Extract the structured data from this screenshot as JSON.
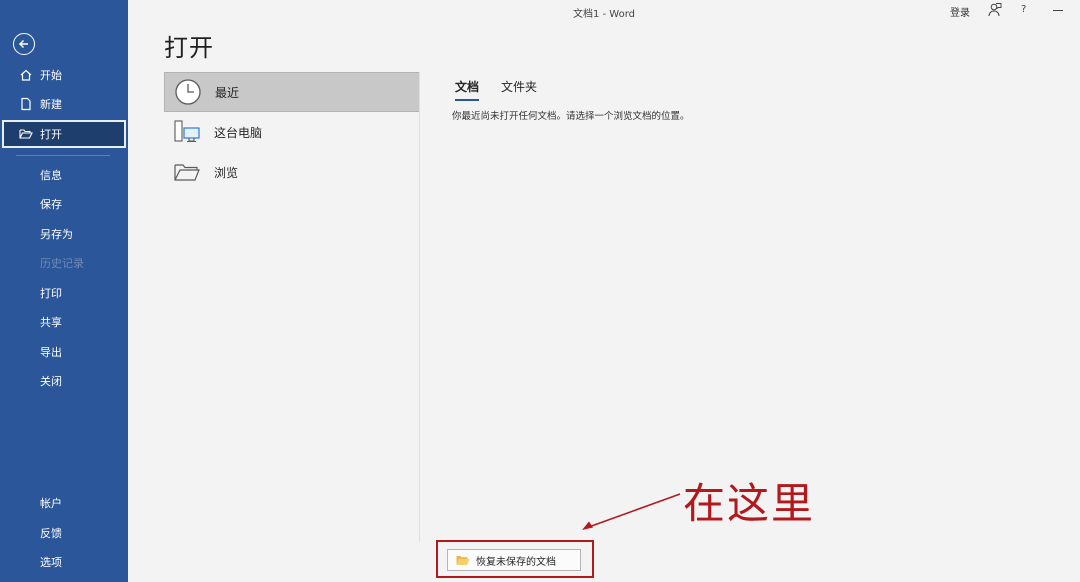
{
  "window": {
    "title": "文档1  -  Word",
    "signin": "登录",
    "help": "?"
  },
  "sidebar": {
    "items": [
      {
        "label": "开始",
        "icon": "home-icon"
      },
      {
        "label": "新建",
        "icon": "new-document-icon"
      },
      {
        "label": "打开",
        "icon": "open-folder-icon",
        "active": true
      },
      {
        "label": "信息"
      },
      {
        "label": "保存"
      },
      {
        "label": "另存为"
      },
      {
        "label": "历史记录",
        "disabled": true
      },
      {
        "label": "打印"
      },
      {
        "label": "共享"
      },
      {
        "label": "导出"
      },
      {
        "label": "关闭"
      }
    ],
    "bottom": [
      {
        "label": "帐户"
      },
      {
        "label": "反馈"
      },
      {
        "label": "选项"
      }
    ]
  },
  "page": {
    "title": "打开"
  },
  "places": [
    {
      "label": "最近",
      "icon": "clock-icon",
      "selected": true
    },
    {
      "label": "这台电脑",
      "icon": "computer-icon"
    },
    {
      "label": "浏览",
      "icon": "folder-icon"
    }
  ],
  "tabs": [
    {
      "label": "文档",
      "active": true
    },
    {
      "label": "文件夹"
    }
  ],
  "empty_message": "你最近尚未打开任何文档。请选择一个浏览文档的位置。",
  "recover_button": {
    "label": "恢复未保存的文档",
    "icon": "folder-icon"
  },
  "annotation": {
    "text": "在这里",
    "color": "#b3181d"
  },
  "colors": {
    "sidebar": "#2b579a",
    "accent": "#2b579a",
    "highlight": "#b3181d"
  }
}
